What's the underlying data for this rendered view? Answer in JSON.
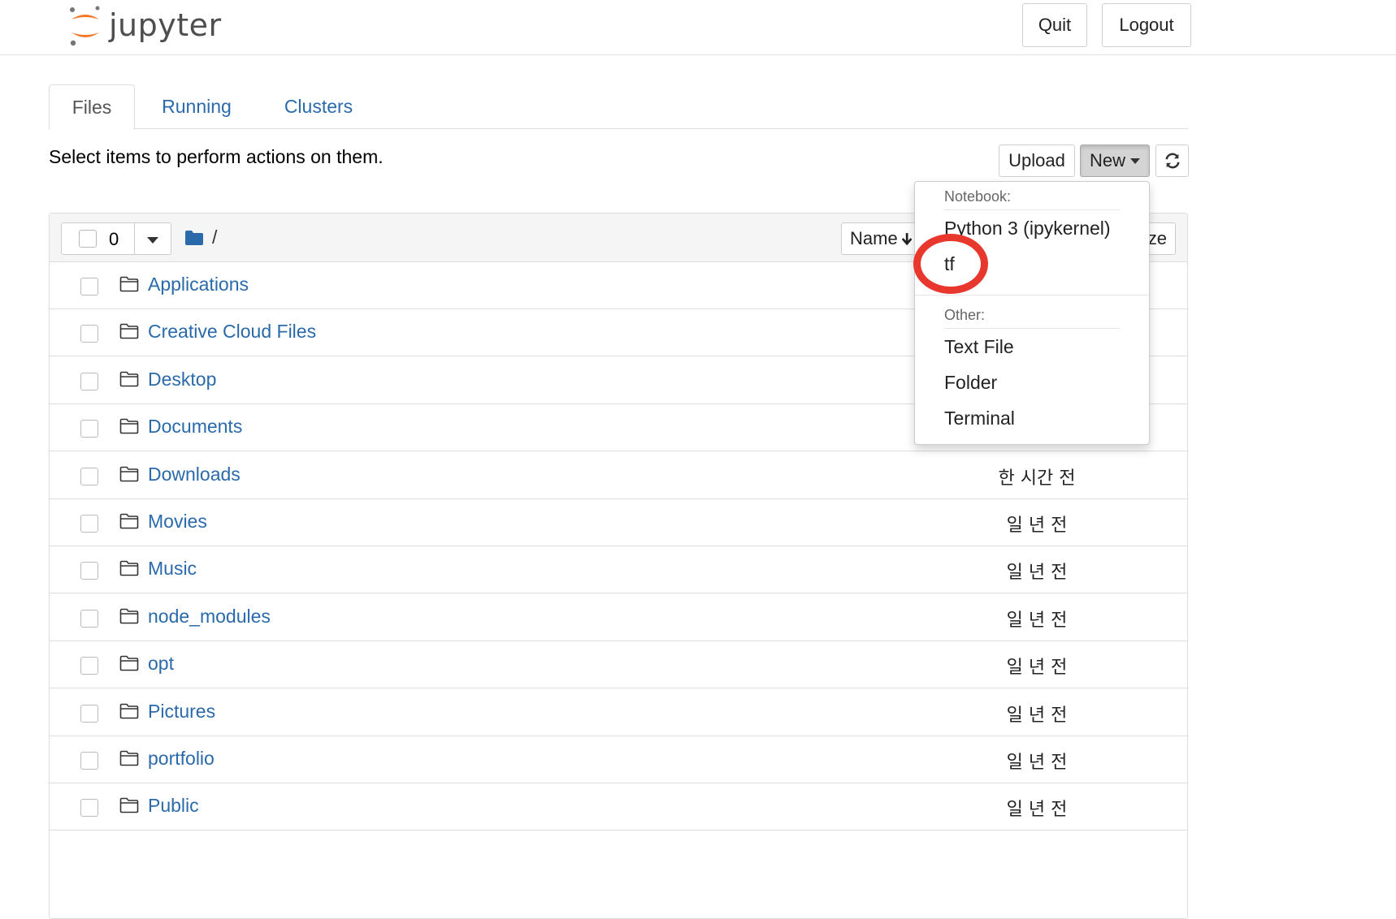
{
  "header": {
    "logo_text": "jupyter",
    "quit_label": "Quit",
    "logout_label": "Logout"
  },
  "tabs": [
    {
      "label": "Files",
      "active": true
    },
    {
      "label": "Running",
      "active": false
    },
    {
      "label": "Clusters",
      "active": false
    }
  ],
  "toolbar": {
    "hint": "Select items to perform actions on them.",
    "upload_label": "Upload",
    "new_label": "New"
  },
  "list_header": {
    "selected_count": "0",
    "breadcrumb": "/",
    "sort_name_label": "Name",
    "sort_size_label": "ze"
  },
  "files": [
    {
      "name": "Applications",
      "modified": ""
    },
    {
      "name": "Creative Cloud Files",
      "modified": ""
    },
    {
      "name": "Desktop",
      "modified": ""
    },
    {
      "name": "Documents",
      "modified": ""
    },
    {
      "name": "Downloads",
      "modified": "한 시간 전"
    },
    {
      "name": "Movies",
      "modified": "일 년 전"
    },
    {
      "name": "Music",
      "modified": "일 년 전"
    },
    {
      "name": "node_modules",
      "modified": "일 년 전"
    },
    {
      "name": "opt",
      "modified": "일 년 전"
    },
    {
      "name": "Pictures",
      "modified": "일 년 전"
    },
    {
      "name": "portfolio",
      "modified": "일 년 전"
    },
    {
      "name": "Public",
      "modified": "일 년 전"
    }
  ],
  "new_menu": {
    "notebook_header": "Notebook:",
    "notebook_items": [
      "Python 3 (ipykernel)",
      "tf"
    ],
    "other_header": "Other:",
    "other_items": [
      "Text File",
      "Folder",
      "Terminal"
    ]
  },
  "colors": {
    "link": "#2a6aab",
    "logo_orange": "#f37726",
    "annotation_ring": "#e8372c"
  },
  "icons": {
    "folder": "folder-icon",
    "sort": "arrow-down-icon",
    "refresh": "refresh-icon"
  }
}
